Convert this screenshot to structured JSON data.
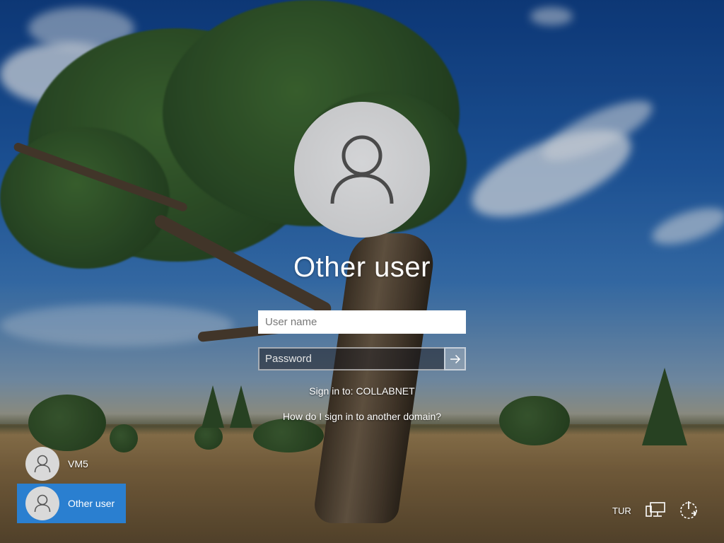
{
  "login": {
    "title": "Other user",
    "username_placeholder": "User name",
    "password_placeholder": "Password",
    "sign_in_to": "Sign in to: COLLABNET",
    "domain_link": "How do I sign in to another domain?"
  },
  "users": [
    {
      "name": "VM5",
      "selected": false
    },
    {
      "name": "Other user",
      "selected": true
    }
  ],
  "tray": {
    "language": "TUR",
    "icons": [
      "network-icon",
      "power-icon"
    ]
  },
  "colors": {
    "selected_user_bg": "#2a7fd0",
    "avatar_bg": "#c6c7c9"
  }
}
